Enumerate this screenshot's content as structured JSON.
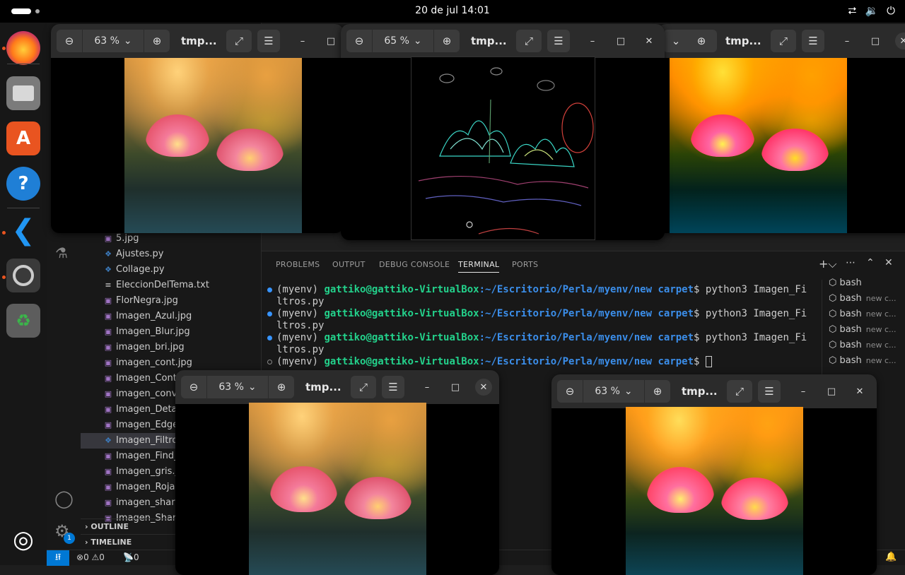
{
  "topbar": {
    "clock": "20 de jul  14:01"
  },
  "dock": {
    "items": [
      "firefox",
      "files",
      "app-center",
      "help",
      "vscode",
      "image-viewer",
      "trash",
      "show-apps"
    ]
  },
  "explorer": {
    "files": [
      {
        "name": "5.jpg",
        "icon": "image-icon"
      },
      {
        "name": "Ajustes.py",
        "icon": "python-icon"
      },
      {
        "name": "Collage.py",
        "icon": "python-icon"
      },
      {
        "name": "EleccionDelTema.txt",
        "icon": "text-icon"
      },
      {
        "name": "FlorNegra.jpg",
        "icon": "image-icon"
      },
      {
        "name": "Imagen_Azul.jpg",
        "icon": "image-icon"
      },
      {
        "name": "Imagen_Blur.jpg",
        "icon": "image-icon"
      },
      {
        "name": "imagen_bri.jpg",
        "icon": "image-icon"
      },
      {
        "name": "imagen_cont.jpg",
        "icon": "image-icon"
      },
      {
        "name": "Imagen_Conto",
        "icon": "image-icon"
      },
      {
        "name": "imagen_conve",
        "icon": "image-icon"
      },
      {
        "name": "Imagen_Detail",
        "icon": "image-icon"
      },
      {
        "name": "Imagen_Edge.",
        "icon": "image-icon"
      },
      {
        "name": "Imagen_Filtros",
        "icon": "python-icon"
      },
      {
        "name": "Imagen_Find_I",
        "icon": "image-icon"
      },
      {
        "name": "Imagen_gris.jp",
        "icon": "image-icon"
      },
      {
        "name": "Imagen_Roja.jp",
        "icon": "image-icon"
      },
      {
        "name": "imagen_sharp.",
        "icon": "image-icon"
      },
      {
        "name": "Imagen_Sharp",
        "icon": "image-icon"
      }
    ],
    "selected_index": 13,
    "outline": "OUTLINE",
    "timeline": "TIMELINE"
  },
  "panel": {
    "tabs": [
      "PROBLEMS",
      "OUTPUT",
      "DEBUG CONSOLE",
      "TERMINAL",
      "PORTS"
    ],
    "active_tab": "TERMINAL",
    "terminal": [
      {
        "env": "(myenv) ",
        "user": "gattiko@gattiko-VirtualBox",
        "path": ":~/Escritorio/Perla/myenv/new carpet",
        "cmd": "$ python3 Imagen_Fi",
        "wrap": "ltros.py"
      },
      {
        "env": "(myenv) ",
        "user": "gattiko@gattiko-VirtualBox",
        "path": ":~/Escritorio/Perla/myenv/new carpet",
        "cmd": "$ python3 Imagen_Fi",
        "wrap": "ltros.py"
      },
      {
        "env": "(myenv) ",
        "user": "gattiko@gattiko-VirtualBox",
        "path": ":~/Escritorio/Perla/myenv/new carpet",
        "cmd": "$ python3 Imagen_Fi",
        "wrap": "ltros.py"
      },
      {
        "env": "(myenv) ",
        "user": "gattiko@gattiko-VirtualBox",
        "path": ":~/Escritorio/Perla/myenv/new carpet",
        "cmd": "$ ",
        "wrap": ""
      }
    ],
    "terminal_list": [
      {
        "name": "bash",
        "sub": ""
      },
      {
        "name": "bash",
        "sub": "new c..."
      },
      {
        "name": "bash",
        "sub": "new c..."
      },
      {
        "name": "bash",
        "sub": "new c..."
      },
      {
        "name": "bash",
        "sub": "new c..."
      },
      {
        "name": "bash",
        "sub": "new c..."
      }
    ]
  },
  "statusbar": {
    "errors": "0",
    "warnings": "0",
    "ports": "0"
  },
  "viewers": [
    {
      "zoom": "63 %",
      "title": "tmp..."
    },
    {
      "zoom": "65 %",
      "title": "tmp..."
    },
    {
      "zoom": "",
      "title": "tmp..."
    },
    {
      "zoom": "63 %",
      "title": "tmp..."
    },
    {
      "zoom": "63 %",
      "title": "tmp..."
    }
  ],
  "settings_badge": "1"
}
